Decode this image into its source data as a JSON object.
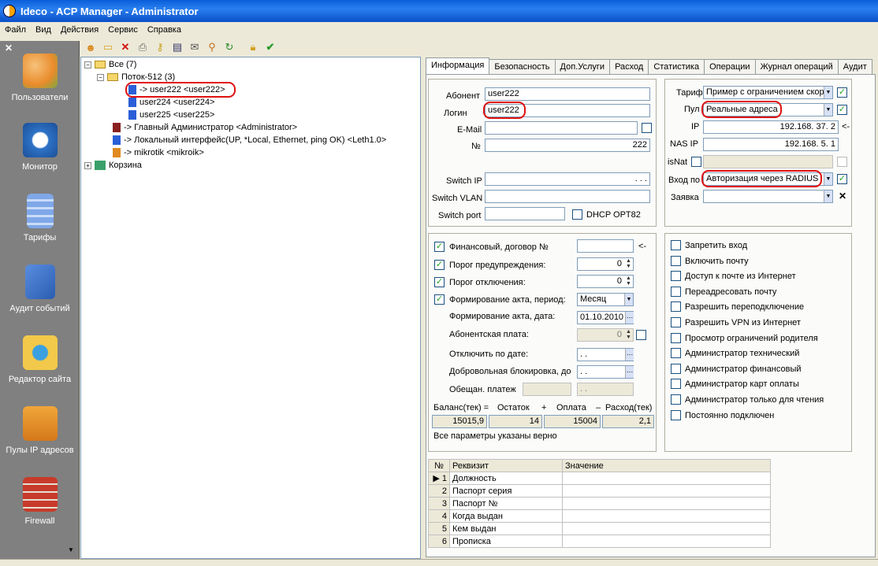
{
  "window": {
    "title": "Ideco - ACP Manager - Administrator"
  },
  "menu": [
    "Файл",
    "Вид",
    "Действия",
    "Сервис",
    "Справка"
  ],
  "sidebar": {
    "items": [
      {
        "label": "Пользователи",
        "icon": "users-icon",
        "color": "#e98b2b"
      },
      {
        "label": "Монитор",
        "icon": "clock-icon",
        "color": "#2e73c7"
      },
      {
        "label": "Тарифы",
        "icon": "calculator-icon",
        "color": "#7fa7e8"
      },
      {
        "label": "Аудит событий",
        "icon": "checklist-icon",
        "color": "#2a5db0"
      },
      {
        "label": "Редактор сайта",
        "icon": "globe-icon",
        "color": "#f2c94a"
      },
      {
        "label": "Пулы IP адресов",
        "icon": "tools-icon",
        "color": "#f0a63a"
      },
      {
        "label": "Firewall",
        "icon": "firewall-icon",
        "color": "#c83a2a"
      }
    ]
  },
  "tree": [
    {
      "text": "Все (7)",
      "type": "folder"
    },
    {
      "text": "Поток-512 (3)",
      "type": "folder"
    },
    {
      "text": "-> user222 <user222>",
      "type": "user"
    },
    {
      "text": "user224 <user224>",
      "type": "user"
    },
    {
      "text": "user225 <user225>",
      "type": "user"
    },
    {
      "text": "-> Главный Администратор <Administrator>",
      "type": "admin"
    },
    {
      "text": "-> Локальный интерфейс(UP, *Local, Ethernet, ping OK) <Leth1.0>",
      "type": "iface"
    },
    {
      "text": "-> mikrotik <mikroik>",
      "type": "user"
    },
    {
      "text": "Корзина",
      "type": "trash"
    }
  ],
  "tabs": [
    "Информация",
    "Безопасность",
    "Доп.Услуги",
    "Расход",
    "Статистика",
    "Операции",
    "Журнал операций",
    "Аудит"
  ],
  "info": {
    "abonent_label": "Абонент",
    "abonent": "user222",
    "login_label": "Логин",
    "login": "user222",
    "email_label": "E-Mail",
    "email": "",
    "num_label": "№",
    "num": "222",
    "switch_ip_label": "Switch IP",
    "switch_ip": ". . .",
    "switch_vlan_label": "Switch VLAN",
    "switch_vlan": "",
    "switch_port_label": "Switch port",
    "switch_port": "",
    "dhcp_label": "DHCP OPT82"
  },
  "tariff": {
    "tarif_label": "Тариф",
    "tarif": "Пример с ограничением скор",
    "pool_label": "Пул",
    "pool": "Реальные адреса",
    "ip_label": "IP",
    "ip": "192.168. 37. 2",
    "ip_arrow": "<-",
    "nasip_label": "NAS IP",
    "nasip": "192.168. 5. 1",
    "isnat_label": "isNat",
    "login_by_label": "Вход по",
    "login_by": "Авторизация через RADIUS",
    "request_label": "Заявка",
    "request": "",
    "clear": "✕"
  },
  "finance": {
    "contract_label": "Финансовый, договор №",
    "contract": "",
    "contract_arrow": "<-",
    "warn_label": "Порог предупреждения:",
    "warn": "0",
    "off_label": "Порог отключения:",
    "off": "0",
    "act_period_label": "Формирование акта, период:",
    "act_period": "Месяц",
    "act_date_label": "Формирование акта, дата:",
    "act_date": "01.10.2010",
    "fee_label": "Абонентская плата:",
    "fee": "0",
    "off_date_label": "Отключить по дате:",
    "off_date": ". .",
    "voluntary_label": "Добровольная блокировка, до",
    "voluntary": ". .",
    "promised_label": "Обещан. платеж",
    "promised": ". .",
    "balance_header": [
      "Баланс(тек) =",
      "Остаток",
      "+",
      "Оплата",
      "–",
      "Расход(тек)"
    ],
    "balance_values": [
      "15015,9",
      "14",
      "15004",
      "2,1"
    ],
    "status": "Все параметры указаны верно"
  },
  "flags": [
    "Запретить вход",
    "Включить почту",
    "Доступ к почте из Интернет",
    "Переадресовать почту",
    "Разрешить переподключение",
    "Разрешить VPN из Интернет",
    "Просмотр ограничений родителя",
    "Администратор технический",
    "Администратор финансовый",
    "Администратор карт оплаты",
    "Администратор только для чтения",
    "Постоянно подключен"
  ],
  "grid": {
    "headers": [
      "№",
      "Реквизит",
      "Значение"
    ],
    "rows": [
      [
        "1",
        "Должность",
        ""
      ],
      [
        "2",
        "Паспорт серия",
        ""
      ],
      [
        "3",
        "Паспорт №",
        ""
      ],
      [
        "4",
        "Когда выдан",
        ""
      ],
      [
        "5",
        "Кем выдан",
        ""
      ],
      [
        "6",
        "Прописка",
        ""
      ]
    ]
  }
}
